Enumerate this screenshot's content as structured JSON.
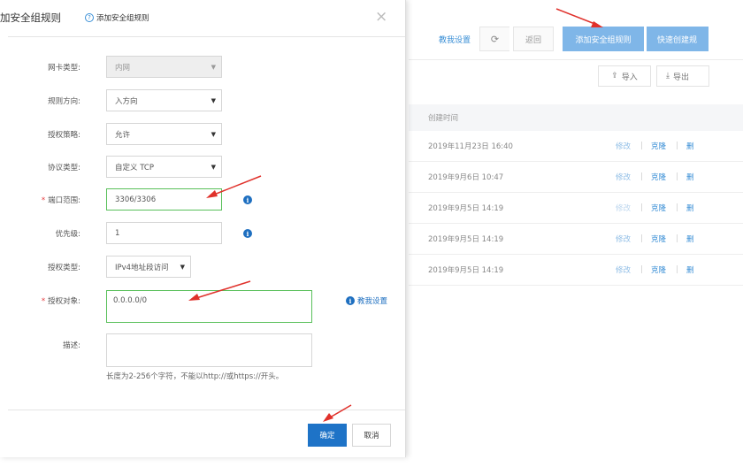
{
  "background": {
    "toolbar": {
      "custom_link": "教我设置",
      "refresh_icon": "refresh-icon",
      "back_label": "返回",
      "add_rule_label": "添加安全组规则",
      "quick_create_label": "快速创建规"
    },
    "import_label": "导入",
    "export_label": "导出",
    "table": {
      "column_created": "创建时间",
      "rows": [
        {
          "time": "2019年11月23日 16:40",
          "edit": "修改",
          "clone": "克隆",
          "del": "删"
        },
        {
          "time": "2019年9月6日 10:47",
          "edit": "修改",
          "clone": "克隆",
          "del": "删"
        },
        {
          "time": "2019年9月5日 14:19",
          "edit": "修改",
          "clone": "克隆",
          "del": "删"
        },
        {
          "time": "2019年9月5日 14:19",
          "edit": "修改",
          "clone": "克隆",
          "del": "删"
        },
        {
          "time": "2019年9月5日 14:19",
          "edit": "修改",
          "clone": "克隆",
          "del": "删"
        }
      ]
    }
  },
  "dialog": {
    "title": "加安全组规则",
    "help_text": "添加安全组规则",
    "close": "×",
    "fields": {
      "nic_type": {
        "label": "网卡类型:",
        "value": "内网"
      },
      "direction": {
        "label": "规则方向:",
        "value": "入方向"
      },
      "policy": {
        "label": "授权策略:",
        "value": "允许"
      },
      "protocol": {
        "label": "协议类型:",
        "value": "自定义 TCP"
      },
      "port_range": {
        "label": "端口范围:",
        "value": "3306/3306",
        "required": "*"
      },
      "priority": {
        "label": "优先级:",
        "value": "1"
      },
      "auth_type": {
        "label": "授权类型:",
        "value": "IPv4地址段访问"
      },
      "auth_object": {
        "label": "授权对象:",
        "value": "0.0.0.0/0",
        "required": "*"
      },
      "description": {
        "label": "描述:",
        "value": ""
      }
    },
    "help_link": "教我设置",
    "description_hint": "长度为2-256个字符，不能以http://或https://开头。",
    "ok_label": "确定",
    "cancel_label": "取消"
  },
  "annotation_color": "#e0312b"
}
